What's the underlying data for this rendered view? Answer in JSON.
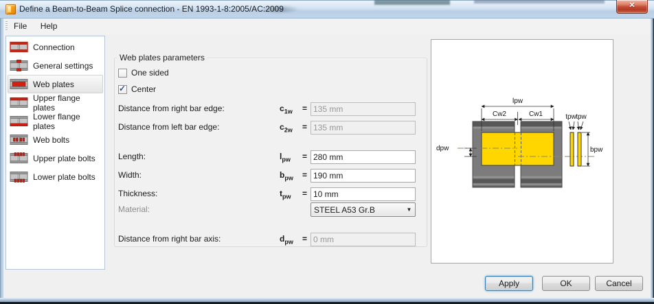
{
  "window": {
    "title": "Define a Beam-to-Beam Splice connection - EN 1993-1-8:2005/AC:2009"
  },
  "icons": {
    "close": "✕",
    "dropdown": "▼",
    "check": "✓"
  },
  "menu": {
    "items": [
      {
        "label": "File"
      },
      {
        "label": "Help"
      }
    ]
  },
  "sidebar": {
    "selected": "Web plates",
    "items": [
      {
        "label": "Connection"
      },
      {
        "label": "General settings"
      },
      {
        "label": "Web plates"
      },
      {
        "label": "Upper flange plates"
      },
      {
        "label": "Lower flange plates"
      },
      {
        "label": "Web bolts"
      },
      {
        "label": "Upper plate bolts"
      },
      {
        "label": "Lower plate bolts"
      }
    ]
  },
  "panel": {
    "title": "Web plates parameters",
    "equals": "=",
    "checkboxes": [
      {
        "label": "One sided",
        "checked": false
      },
      {
        "label": "Center",
        "checked": true
      }
    ],
    "fields": [
      {
        "label": "Distance from right bar edge:",
        "symbol": "c",
        "subscript": "1w",
        "value": "135 mm",
        "disabled": true
      },
      {
        "label": "Distance from left bar edge:",
        "symbol": "c",
        "subscript": "2w",
        "value": "135 mm",
        "disabled": true
      },
      {
        "label": "Length:",
        "symbol": "l",
        "subscript": "pw",
        "value": "280 mm",
        "disabled": false
      },
      {
        "label": "Width:",
        "symbol": "b",
        "subscript": "pw",
        "value": "190 mm",
        "disabled": false
      },
      {
        "label": "Thickness:",
        "symbol": "t",
        "subscript": "pw",
        "value": "10 mm",
        "disabled": false
      },
      {
        "label": "Distance from right bar axis:",
        "symbol": "d",
        "subscript": "pw",
        "value": "0 mm",
        "disabled": true
      }
    ],
    "material": {
      "label": "Material:",
      "value": "STEEL A53 Gr.B"
    }
  },
  "diagram": {
    "labels": {
      "lpw": "lpw",
      "cw2": "Cw2",
      "cw1": "Cw1",
      "dpw": "dpw",
      "tpw1": "tpw",
      "tpw2": "tpw",
      "bpw": "bpw"
    }
  },
  "footer": {
    "buttons": [
      {
        "label": "Apply"
      },
      {
        "label": "OK"
      },
      {
        "label": "Cancel"
      }
    ]
  },
  "colors": {
    "plate_yellow": "#ffd600",
    "beam_gray": "#7b7b7b",
    "icon_red": "#d32011",
    "focus_blue": "#3c7fb1",
    "titlebar_blue": "#c2d5e9"
  }
}
